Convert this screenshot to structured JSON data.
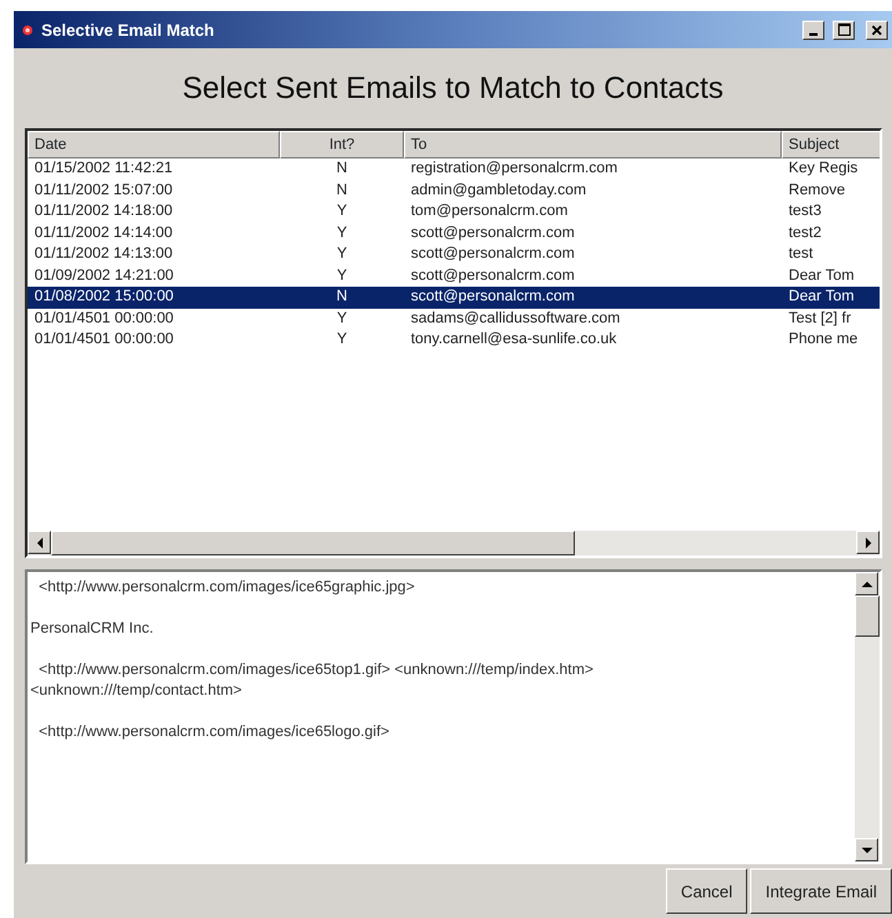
{
  "window": {
    "title": "Selective Email Match"
  },
  "heading": "Select Sent Emails to Match to Contacts",
  "table": {
    "columns": [
      "Date",
      "Int?",
      "To",
      "Subject"
    ],
    "rows": [
      {
        "cells": [
          "01/15/2002 11:42:21",
          "N",
          "registration@personalcrm.com",
          "Key Regis"
        ],
        "selected": false
      },
      {
        "cells": [
          "01/11/2002 15:07:00",
          "N",
          "admin@gambletoday.com",
          "Remove"
        ],
        "selected": false
      },
      {
        "cells": [
          "01/11/2002 14:18:00",
          "Y",
          "tom@personalcrm.com",
          "test3"
        ],
        "selected": false
      },
      {
        "cells": [
          "01/11/2002 14:14:00",
          "Y",
          "scott@personalcrm.com",
          "test2"
        ],
        "selected": false
      },
      {
        "cells": [
          "01/11/2002 14:13:00",
          "Y",
          "scott@personalcrm.com",
          "test"
        ],
        "selected": false
      },
      {
        "cells": [
          "01/09/2002 14:21:00",
          "Y",
          "scott@personalcrm.com",
          "Dear Tom"
        ],
        "selected": false
      },
      {
        "cells": [
          "01/08/2002 15:00:00",
          "N",
          "scott@personalcrm.com",
          "Dear Tom"
        ],
        "selected": true
      },
      {
        "cells": [
          "01/01/4501 00:00:00",
          "Y",
          "sadams@callidussoftware.com",
          "Test [2] fr"
        ],
        "selected": false
      },
      {
        "cells": [
          "01/01/4501 00:00:00",
          "Y",
          "tony.carnell@esa-sunlife.co.uk",
          "Phone me"
        ],
        "selected": false
      }
    ]
  },
  "message_body": [
    [
      "  <http://www.personalcrm.com/images/ice65graphic.jpg>"
    ],
    [
      "PersonalCRM Inc."
    ],
    [
      "  <http://www.personalcrm.com/images/ice65top1.gif> <unknown:///temp/index.htm>",
      "<unknown:///temp/contact.htm>"
    ],
    [
      "  <http://www.personalcrm.com/images/ice65logo.gif>"
    ]
  ],
  "buttons": [
    "Cancel",
    "Integrate Email"
  ]
}
